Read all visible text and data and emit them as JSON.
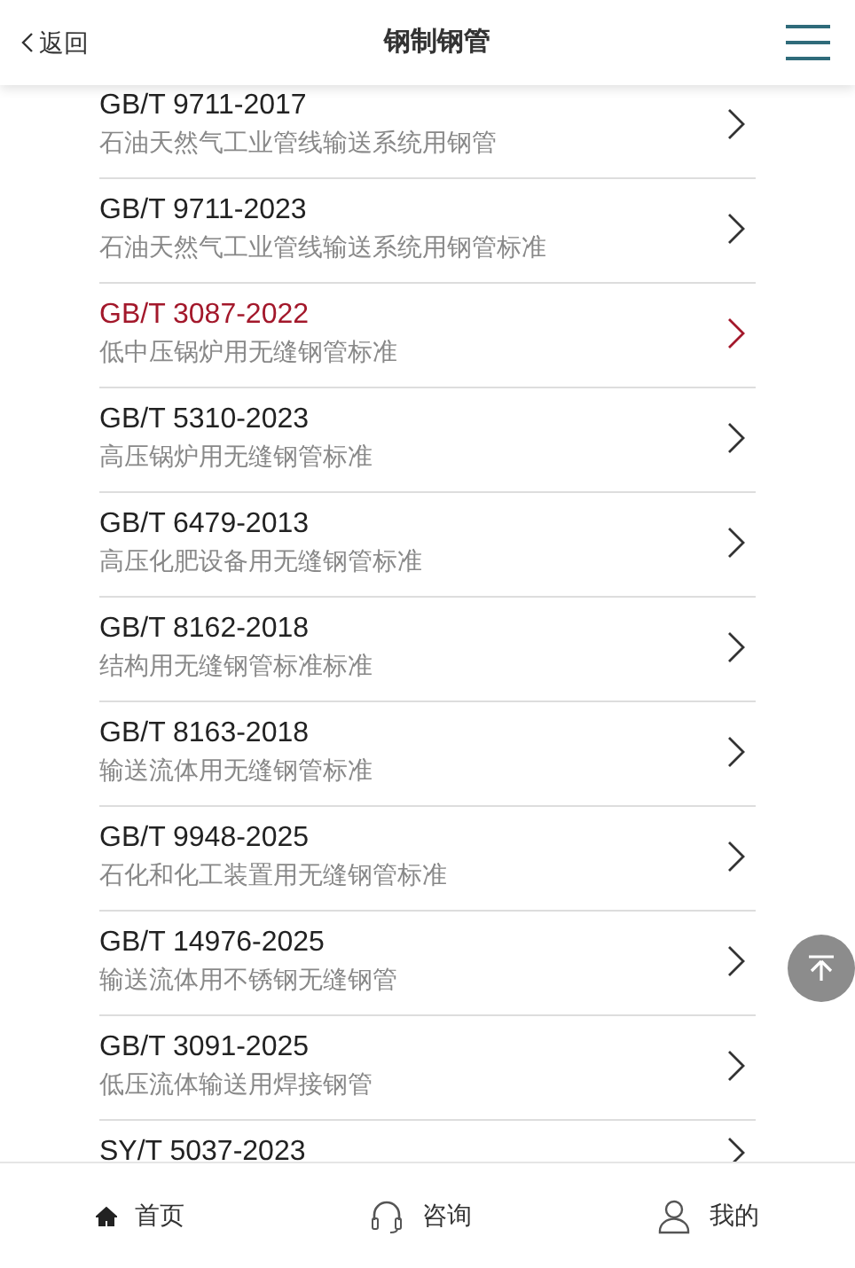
{
  "header": {
    "back": "返回",
    "title": "钢制钢管"
  },
  "items": [
    {
      "code": "GB/T 9711-2017",
      "desc": "石油天然气工业管线输送系统用钢管",
      "selected": false
    },
    {
      "code": "GB/T 9711-2023",
      "desc": "石油天然气工业管线输送系统用钢管标准",
      "selected": false
    },
    {
      "code": "GB/T 3087-2022",
      "desc": "低中压锅炉用无缝钢管标准",
      "selected": true
    },
    {
      "code": "GB/T 5310-2023",
      "desc": "高压锅炉用无缝钢管标准",
      "selected": false
    },
    {
      "code": "GB/T 6479-2013",
      "desc": "高压化肥设备用无缝钢管标准",
      "selected": false
    },
    {
      "code": "GB/T 8162-2018",
      "desc": "结构用无缝钢管标准标准",
      "selected": false
    },
    {
      "code": "GB/T 8163-2018",
      "desc": "输送流体用无缝钢管标准",
      "selected": false
    },
    {
      "code": "GB/T 9948-2025",
      "desc": "石化和化工装置用无缝钢管标准",
      "selected": false
    },
    {
      "code": "GB/T 14976-2025",
      "desc": "输送流体用不锈钢无缝钢管",
      "selected": false
    },
    {
      "code": "GB/T 3091-2025",
      "desc": "低压流体输送用焊接钢管",
      "selected": false
    },
    {
      "code": "SY/T 5037-2023",
      "selected": false
    }
  ],
  "tabbar": [
    {
      "kind": "home",
      "label": "首页",
      "selected": true
    },
    {
      "kind": "consult",
      "label": "咨询",
      "selected": false
    },
    {
      "kind": "user",
      "label": "我的",
      "selected": false
    }
  ]
}
